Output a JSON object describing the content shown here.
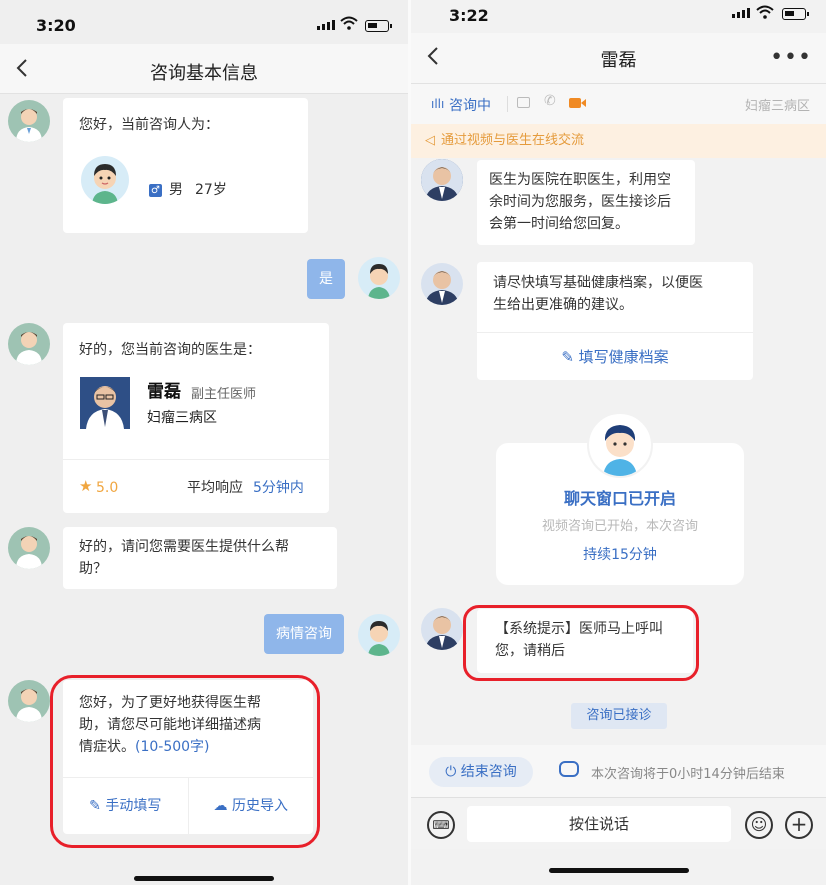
{
  "left": {
    "status": {
      "time": "3:20"
    },
    "nav": {
      "title": "咨询基本信息"
    },
    "msg1": {
      "text": "您好，当前咨询人为：",
      "gender": "男",
      "age": "27岁"
    },
    "reply1": "是",
    "msg2": {
      "text": "好的，您当前咨询的医生是：",
      "doctor_name": "雷磊",
      "doctor_title": "副主任医师",
      "doctor_dept": "妇瘤三病区",
      "rating": "5.0",
      "response_label": "平均响应",
      "response_value": "5分钟内"
    },
    "msg3": {
      "line1": "好的，请问您需要医生提供什么帮",
      "line2": "助？"
    },
    "reply2": "病情咨询",
    "msg4": {
      "line1": "您好，为了更好地获得医生帮",
      "line2": "助，请您尽可能地详细描述病",
      "line3": "情症状。",
      "limit": "(10-500字)",
      "manual": "手动填写",
      "history": "历史导入"
    }
  },
  "right": {
    "status": {
      "time": "3:22"
    },
    "nav": {
      "title": "雷磊"
    },
    "tabs": {
      "live": "咨询中",
      "dept": "妇瘤三病区"
    },
    "notice": "通过视频与医生在线交流",
    "msg1": {
      "line1": "医生为医院在职医生，利用空",
      "line2": "余时间为您服务，医生接诊后",
      "line3": "会第一时间给您回复。"
    },
    "msg2": {
      "line1": "请尽快填写基础健康档案，以便医",
      "line2": "生给出更准确的建议。",
      "action": "填写健康档案"
    },
    "card": {
      "title": "聊天窗口已开启",
      "sub": "视频咨询已开始，本次咨询",
      "duration": "持续15分钟"
    },
    "msg3": {
      "line1": "【系统提示】医师马上呼叫",
      "line2": "您，请稍后"
    },
    "accepted": "咨询已接诊",
    "end": {
      "button": "结束咨询",
      "info": "本次咨询将于0小时14分钟后结束"
    },
    "input": {
      "placeholder": "按住说话"
    }
  },
  "colors": {
    "accent": "#3a6fc4",
    "bubble_me": "#8fb6ea",
    "highlight": "#e8202a",
    "notice": "#e59b3c"
  }
}
